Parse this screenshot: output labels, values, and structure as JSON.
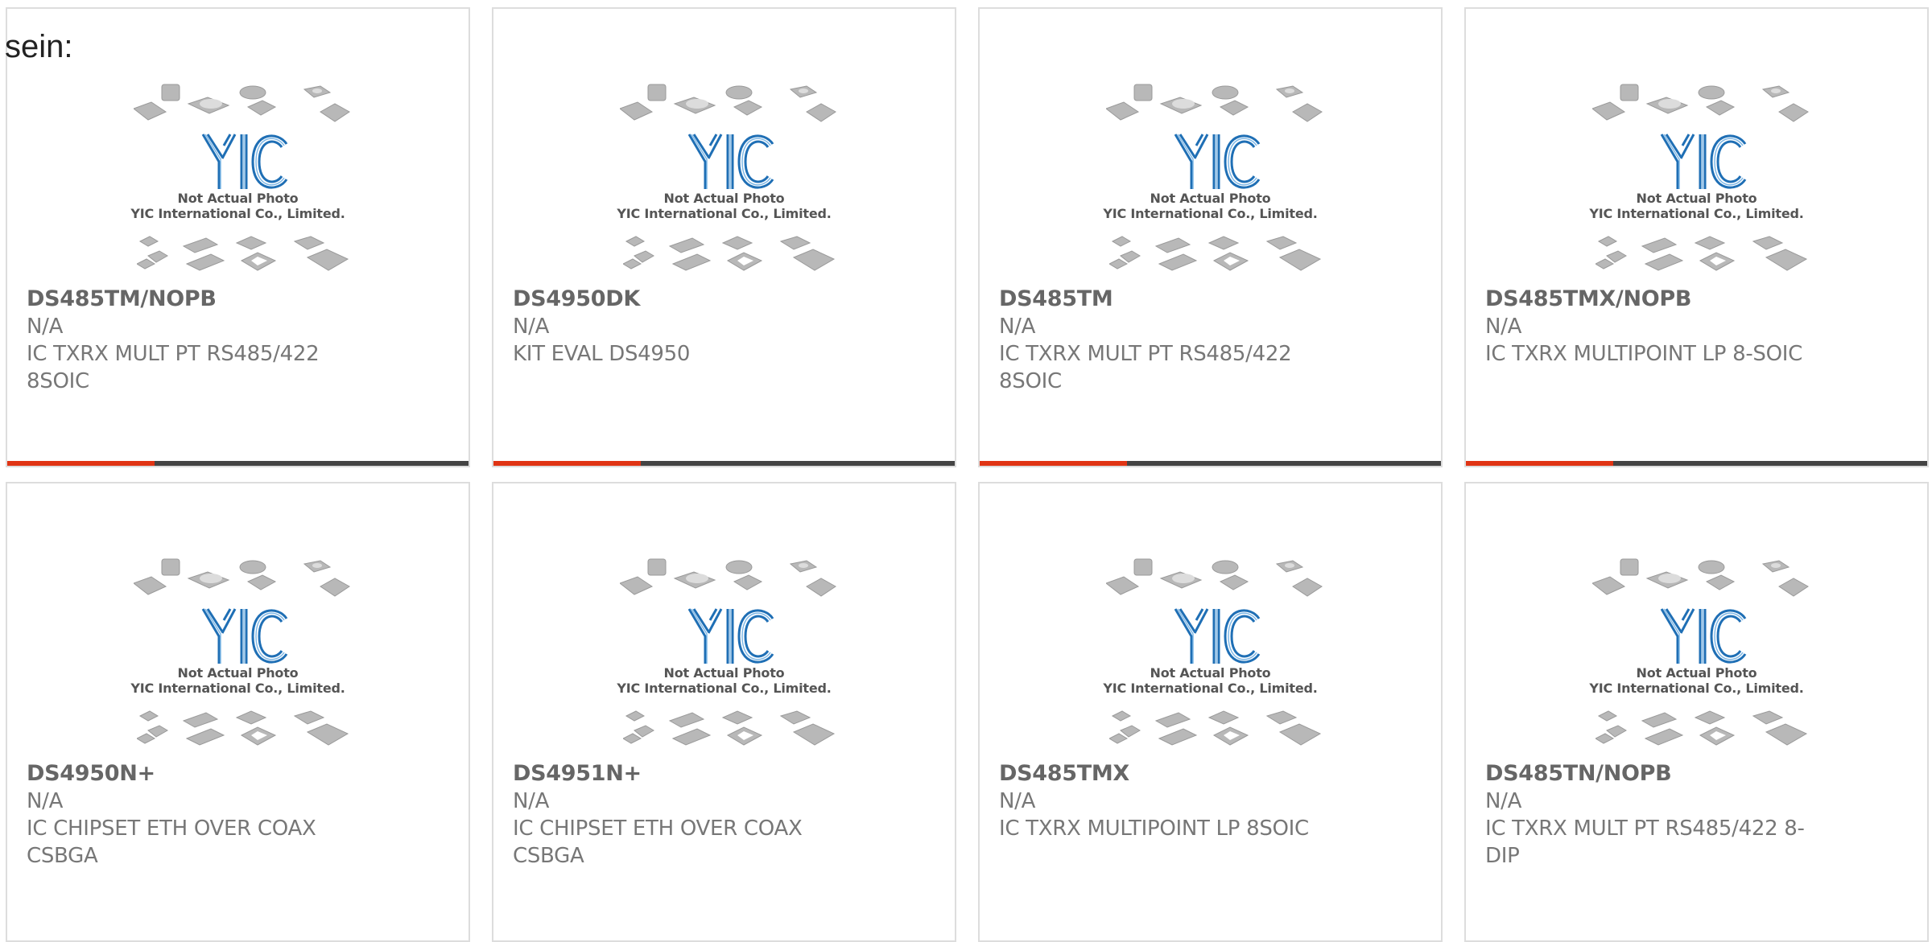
{
  "page_label": "sein:",
  "colors": {
    "accent": "#e03414",
    "bar": "#444444",
    "logo": "#1f6fb5"
  },
  "photo": {
    "caption_line1": "Not Actual Photo",
    "caption_line2": "YIC International Co., Limited.",
    "logo_text": "YIC"
  },
  "cards": [
    {
      "part": "DS485TM/NOPB",
      "mfr": "N/A",
      "desc": "IC TXRX MULT PT RS485/422 8SOIC"
    },
    {
      "part": "DS4950DK",
      "mfr": "N/A",
      "desc": "KIT EVAL DS4950"
    },
    {
      "part": "DS485TM",
      "mfr": "N/A",
      "desc": "IC TXRX MULT PT RS485/422 8SOIC"
    },
    {
      "part": "DS485TMX/NOPB",
      "mfr": "N/A",
      "desc": "IC TXRX MULTIPOINT LP 8-SOIC"
    },
    {
      "part": "DS4950N+",
      "mfr": "N/A",
      "desc": "IC CHIPSET ETH OVER COAX CSBGA"
    },
    {
      "part": "DS4951N+",
      "mfr": "N/A",
      "desc": "IC CHIPSET ETH OVER COAX CSBGA"
    },
    {
      "part": "DS485TMX",
      "mfr": "N/A",
      "desc": "IC TXRX MULTIPOINT LP 8SOIC"
    },
    {
      "part": "DS485TN/NOPB",
      "mfr": "N/A",
      "desc": "IC TXRX MULT PT RS485/422 8-DIP"
    }
  ]
}
